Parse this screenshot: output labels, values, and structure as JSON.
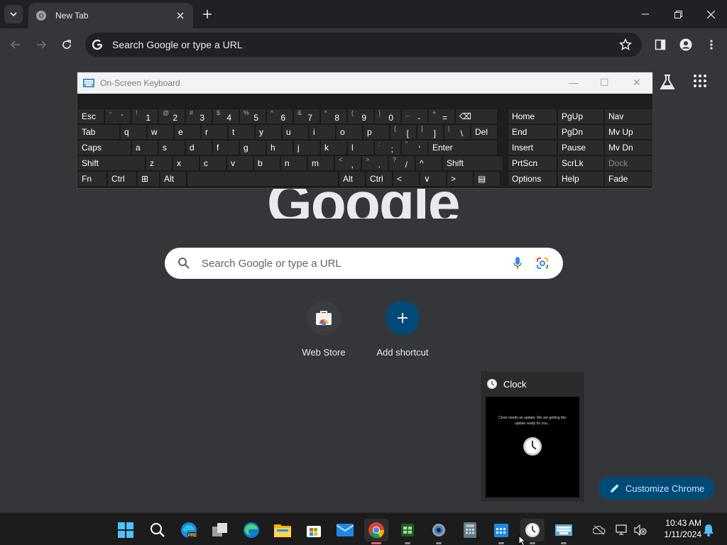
{
  "browser": {
    "tab_title": "New Tab",
    "omnibox_text": "Search Google or type a URL"
  },
  "ntp": {
    "logo": "Google",
    "search_placeholder": "Search Google or type a URL",
    "shortcuts": [
      {
        "label": "Web Store",
        "icon": "web-store-icon"
      },
      {
        "label": "Add shortcut",
        "icon": "plus-icon"
      }
    ],
    "customize_label": "Customize Chrome"
  },
  "osk": {
    "title": "On-Screen Keyboard",
    "rows": [
      [
        "Esc",
        "~ `",
        "! 1",
        "@ 2",
        "# 3",
        "$ 4",
        "% 5",
        "^ 6",
        "& 7",
        "* 8",
        "( 9",
        ") 0",
        "_ -",
        "+ =",
        "⌫"
      ],
      [
        "Tab",
        "q",
        "w",
        "e",
        "r",
        "t",
        "y",
        "u",
        "i",
        "o",
        "p",
        "{ [",
        "} ]",
        "| \\",
        "Del"
      ],
      [
        "Caps",
        "a",
        "s",
        "d",
        "f",
        "g",
        "h",
        "j",
        "k",
        "l",
        ": ;",
        "\" '",
        "Enter"
      ],
      [
        "Shift",
        "z",
        "x",
        "c",
        "v",
        "b",
        "n",
        "m",
        "< ,",
        "> .",
        "? /",
        "^",
        "Shift"
      ],
      [
        "Fn",
        "Ctrl",
        "⊞",
        "Alt",
        "",
        "Alt",
        "Ctrl",
        "<",
        "∨",
        ">",
        "▤"
      ]
    ],
    "nav_keys": [
      [
        "Home",
        "PgUp",
        "Nav"
      ],
      [
        "End",
        "PgDn",
        "Mv Up"
      ],
      [
        "Insert",
        "Pause",
        "Mv Dn"
      ],
      [
        "PrtScn",
        "ScrLk",
        "Dock"
      ],
      [
        "Options",
        "Help",
        "Fade"
      ]
    ]
  },
  "thumbnail": {
    "title": "Clock",
    "message": "Clock needs an update. We are getting this update ready for you..."
  },
  "taskbar": {
    "apps": [
      "start-icon",
      "search-icon",
      "edge-pre-icon",
      "task-view-icon",
      "edge-icon",
      "file-explorer-icon",
      "store-icon",
      "mail-icon",
      "chrome-icon",
      "sheets-icon",
      "settings-icon",
      "calculator-icon",
      "calendar-icon",
      "clock-icon",
      "keyboard-icon"
    ],
    "time": "10:43 AM",
    "date": "1/11/2024"
  }
}
